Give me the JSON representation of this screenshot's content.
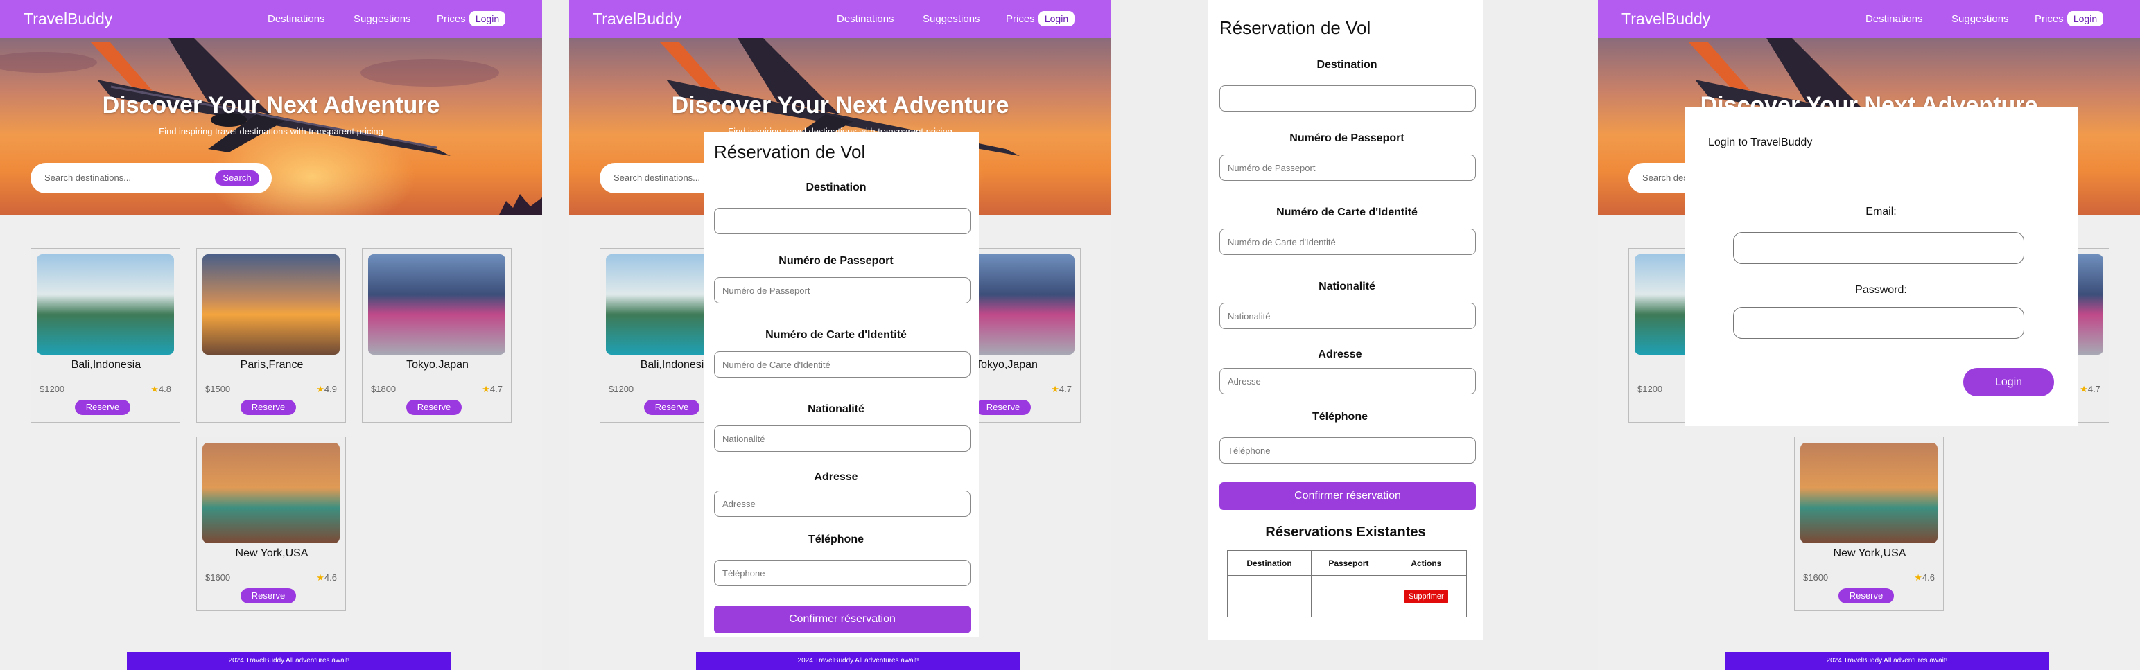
{
  "app": {
    "brand": "TravelBuddy",
    "nav": [
      "Destinations",
      "Suggestions",
      "Prices"
    ],
    "login_label": "Login"
  },
  "hero": {
    "title": "Discover Your Next Adventure",
    "subtitle": "Find inspiring travel destinations with transparent pricing",
    "search_placeholder": "Search destinations...",
    "search_button": "Search"
  },
  "destinations": [
    {
      "name": "Bali,Indonesia",
      "price": "$1200",
      "rating": "4.8",
      "reserve": "Reserve"
    },
    {
      "name": "Paris,France",
      "price": "$1500",
      "rating": "4.9",
      "reserve": "Reserve"
    },
    {
      "name": "Tokyo,Japan",
      "price": "$1800",
      "rating": "4.7",
      "reserve": "Reserve"
    },
    {
      "name": "New York,USA",
      "price": "$1600",
      "rating": "4.6",
      "reserve": "Reserve"
    }
  ],
  "footer": "2024 TravelBuddy.All adventures await!",
  "reservation_form": {
    "title": "Réservation de Vol",
    "fields": [
      {
        "label": "Destination",
        "placeholder": ""
      },
      {
        "label": "Numéro de Passeport",
        "placeholder": "Numéro de Passeport"
      },
      {
        "label": "Numéro de Carte d'Identité",
        "placeholder": "Numéro de Carte d'Identité"
      },
      {
        "label": "Nationalité",
        "placeholder": "Nationalité"
      },
      {
        "label": "Adresse",
        "placeholder": "Adresse"
      },
      {
        "label": "Téléphone",
        "placeholder": "Téléphone"
      }
    ],
    "confirm": "Confirmer réservation"
  },
  "existing": {
    "title": "Réservations Existantes",
    "headers": [
      "Destination",
      "Passeport",
      "Actions"
    ],
    "delete_label": "Supprimer"
  },
  "login_modal": {
    "title": "Login to TravelBuddy",
    "email_label": "Email:",
    "password_label": "Password:",
    "button": "Login"
  },
  "colors": {
    "header": "#b45cf0",
    "accent": "#9b39e0",
    "footer": "#5f12e6",
    "delete": "#e10b0b",
    "star": "#f2b100"
  }
}
